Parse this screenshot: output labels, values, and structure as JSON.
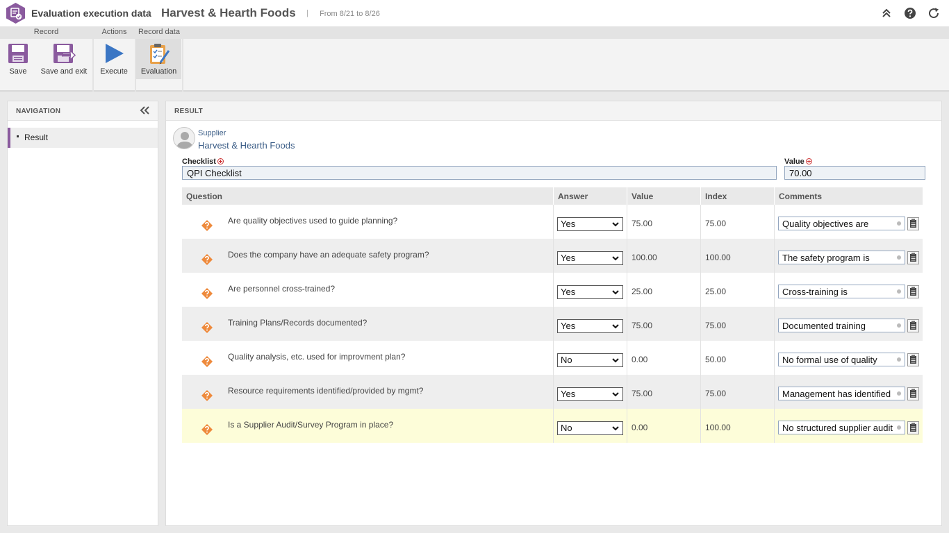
{
  "titlebar": {
    "breadcrumb_parent": "Evaluation execution data",
    "breadcrumb_separator": "›",
    "record_title": "Harvest & Hearth Foods",
    "divider": "|",
    "date_range": "From 8/21 to 8/26",
    "icons": [
      "collapse-up-icon",
      "help-icon",
      "refresh-icon"
    ],
    "logo_color": "#8a5a9e"
  },
  "ribbon": {
    "groups": {
      "record": "Record",
      "actions": "Actions",
      "record_data": "Record data"
    },
    "buttons": {
      "save": "Save",
      "save_and_exit": "Save and exit",
      "execute": "Execute",
      "evaluation": "Evaluation"
    }
  },
  "navigation": {
    "title": "NAVIGATION",
    "items": [
      {
        "label": "Result",
        "active": true
      }
    ],
    "accent_color": "#8a5a9e"
  },
  "result": {
    "title": "RESULT",
    "supplier_label": "Supplier",
    "supplier_name": "Harvest & Hearth Foods",
    "checklist_label": "Checklist",
    "checklist_value": "QPI Checklist",
    "value_label": "Value",
    "value_value": "70.00",
    "table": {
      "headers": {
        "question": "Question",
        "answer": "Answer",
        "value": "Value",
        "index": "Index",
        "comments": "Comments"
      },
      "rows": [
        {
          "question": "Are quality objectives used to guide planning?",
          "answer": "Yes",
          "value": "75.00",
          "index": "75.00",
          "comment": "Quality objectives are"
        },
        {
          "question": "Does the company have an adequate safety program?",
          "answer": "Yes",
          "value": "100.00",
          "index": "100.00",
          "comment": "The safety program is"
        },
        {
          "question": "Are personnel cross-trained?",
          "answer": "Yes",
          "value": "25.00",
          "index": "25.00",
          "comment": "Cross-training is"
        },
        {
          "question": "Training Plans/Records documented?",
          "answer": "Yes",
          "value": "75.00",
          "index": "75.00",
          "comment": "Documented training"
        },
        {
          "question": "Quality analysis, etc. used for improvment plan?",
          "answer": "No",
          "value": "0.00",
          "index": "50.00",
          "comment": "No formal use of quality"
        },
        {
          "question": "Resource requirements identified/provided by mgmt?",
          "answer": "Yes",
          "value": "75.00",
          "index": "75.00",
          "comment": "Management has identified"
        },
        {
          "question": "Is a Supplier Audit/Survey Program in place?",
          "answer": "No",
          "value": "0.00",
          "index": "100.00",
          "comment": "No structured supplier audit"
        }
      ]
    }
  }
}
